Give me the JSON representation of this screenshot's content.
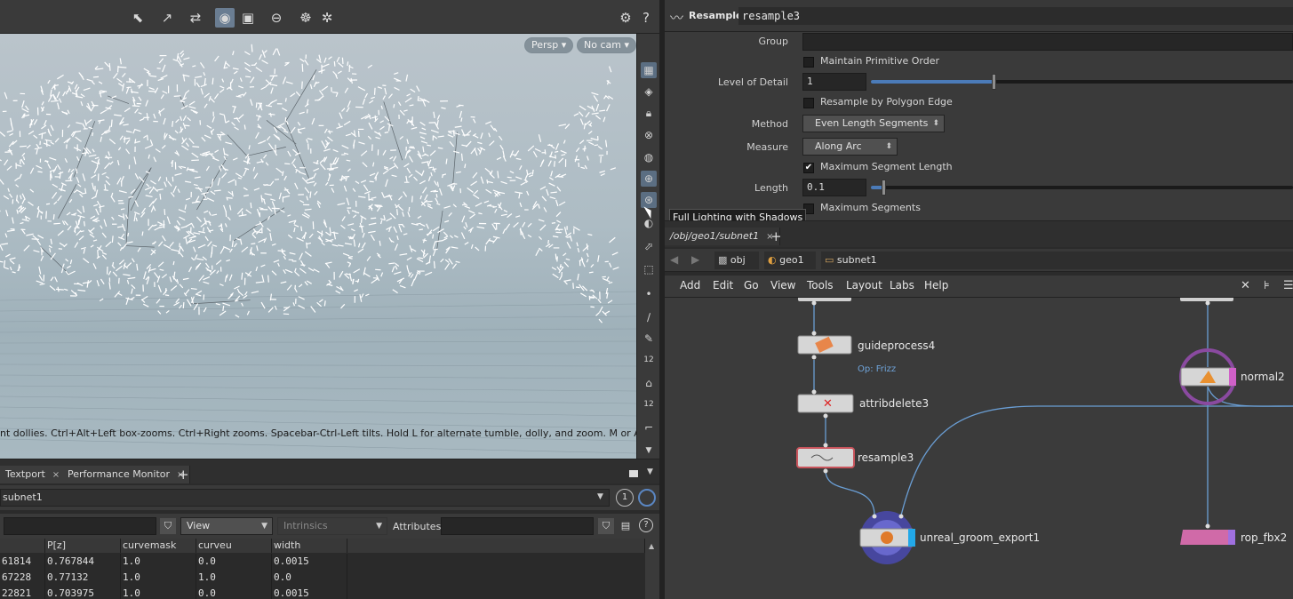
{
  "viewport": {
    "persp_label": "Persp ▾",
    "cam_label": "No cam ▾",
    "status_text": "nt dollies. Ctrl+Alt+Left box-zooms. Ctrl+Right zooms. Spacebar-Ctrl-Left tilts. Hold L for alternate tumble, dolly, and zoom. M or Alt+M for First",
    "tooltip": "Full Lighting with Shadows",
    "strip_labels": [
      "12",
      "12"
    ]
  },
  "sheet": {
    "tabs": [
      {
        "label": "Textport",
        "close": "×"
      },
      {
        "label": "Performance Monitor",
        "close": "×"
      }
    ],
    "add_tab": "+",
    "path": "subnet1",
    "page_num": "1",
    "view_label": "View",
    "intrinsics_label": "Intrinsics",
    "attributes_label": "Attributes:",
    "columns": [
      "",
      "P[z]",
      "curvemask",
      "curveu",
      "width"
    ],
    "rows": [
      [
        "61814",
        "0.767844",
        "1.0",
        "0.0",
        "0.0015"
      ],
      [
        "67228",
        "0.77132",
        "1.0",
        "1.0",
        "0.0"
      ],
      [
        "22821",
        "0.703975",
        "1.0",
        "0.0",
        "0.0015"
      ]
    ]
  },
  "params": {
    "node_type": "Resample",
    "node_name": "resample3",
    "group_label": "Group",
    "group_value": "",
    "maintain_order_label": "Maintain Primitive Order",
    "lod_label": "Level of Detail",
    "lod_value": "1",
    "lod_fraction": 0.29,
    "resample_edge_label": "Resample by Polygon Edge",
    "method_label": "Method",
    "method_value": "Even Length Segments",
    "measure_label": "Measure",
    "measure_value": "Along Arc",
    "max_seg_len_label": "Maximum Segment Length",
    "max_seg_len_checked": true,
    "length_label": "Length",
    "length_value": "0.1",
    "length_fraction": 0.03,
    "max_segments_label": "Maximum Segments"
  },
  "network": {
    "tab_label": "/obj/geo1/subnet1",
    "tab_close": "×",
    "add_tab": "+",
    "crumbs": [
      "obj",
      "geo1",
      "subnet1"
    ],
    "menu": [
      "Add",
      "Edit",
      "Go",
      "View",
      "Tools",
      "Layout",
      "Labs",
      "Help"
    ],
    "nodes": {
      "guideprocess": "guideprocess4",
      "guideprocess_op": "Op: Frizz",
      "attribdelete": "attribdelete3",
      "resample": "resample3",
      "unreal": "unreal_groom_export1",
      "normal": "normal2",
      "rop": "rop_fbx2"
    }
  },
  "colors": {
    "accent_blue": "#4b7bb8",
    "wire": "#6a9ed4",
    "selected_node": "#c9545c",
    "unreal_ring": "#6666c8",
    "normal_ring": "#8a4aa0",
    "rop_pink": "#d06aa8"
  }
}
